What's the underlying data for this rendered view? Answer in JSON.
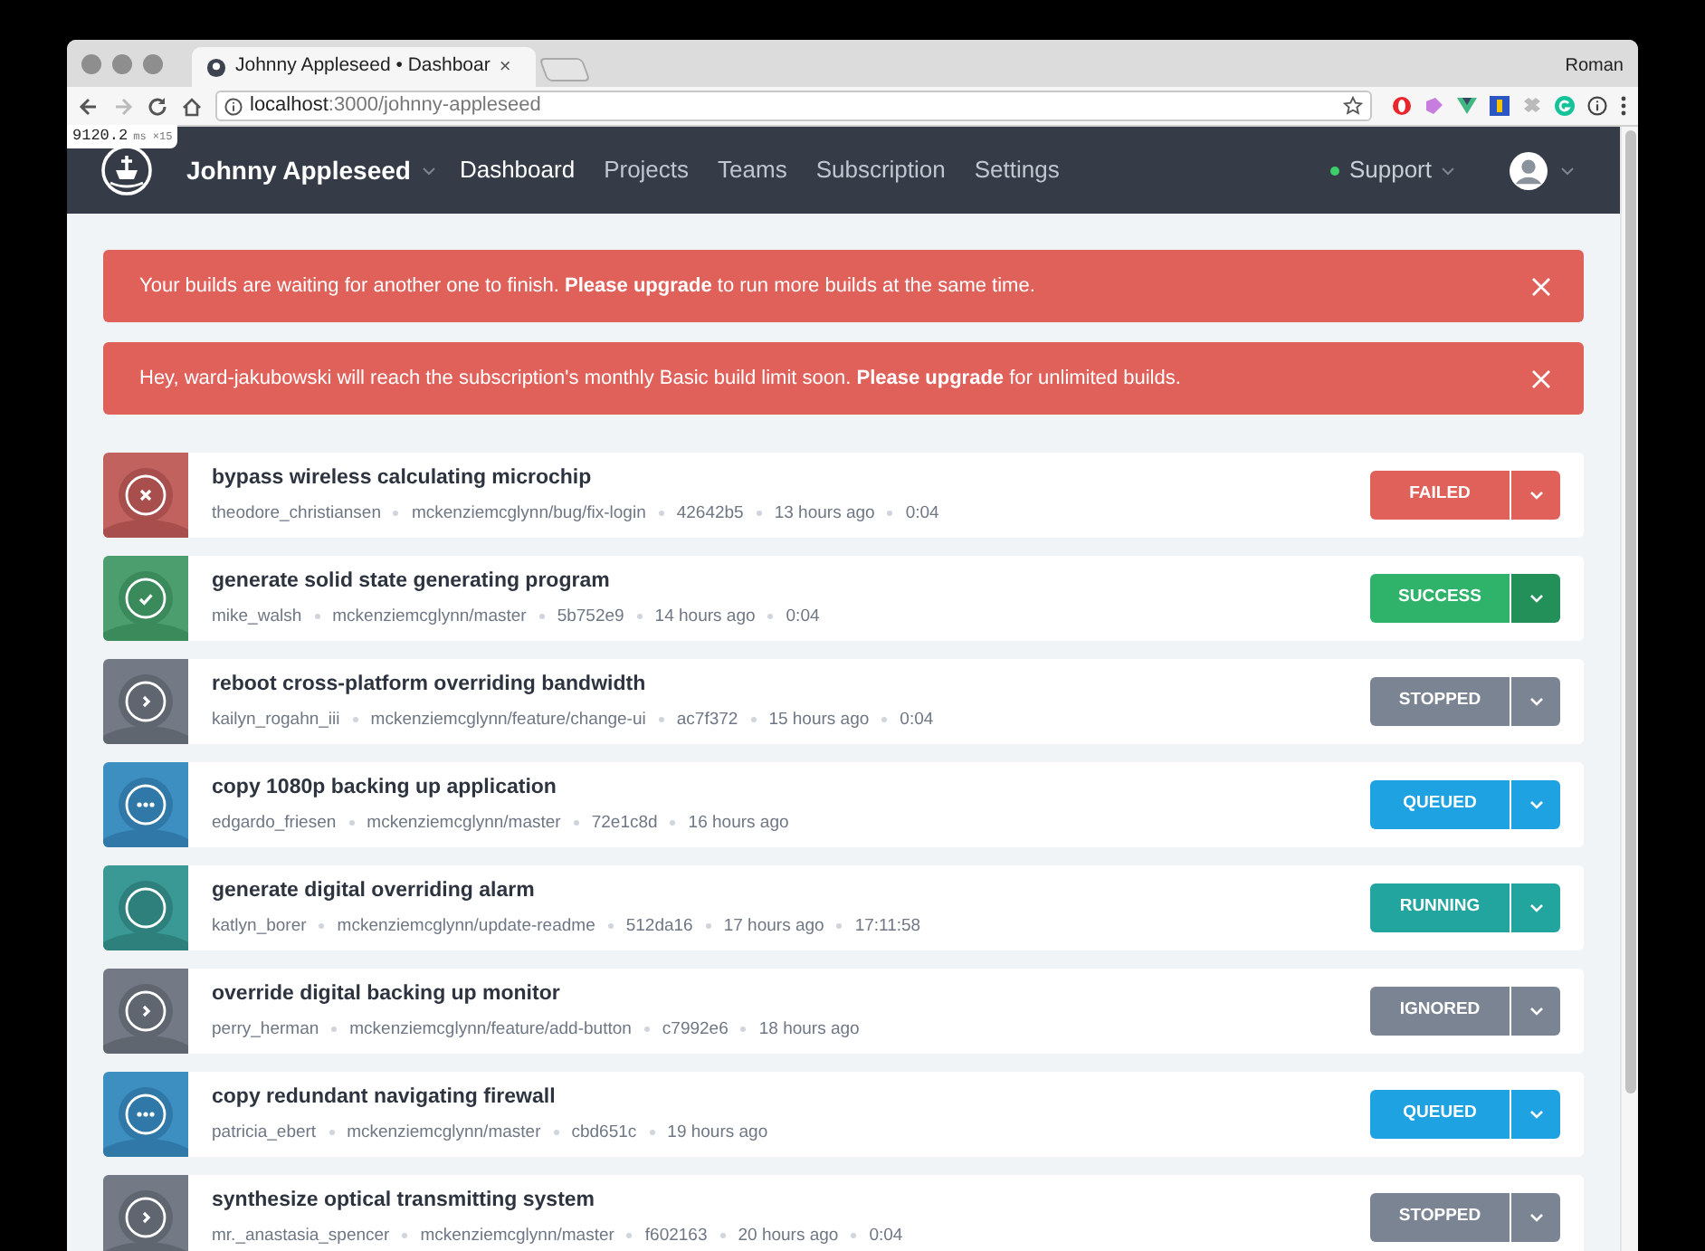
{
  "browser": {
    "tab": {
      "title": "Johnny Appleseed • Dashboar",
      "close": "×",
      "selected": true
    },
    "profile": "Roman",
    "url": {
      "host": "localhost",
      "path": ":3000/johnny-appleseed"
    },
    "perf": {
      "value": "9120.2",
      "unit": "ms ×15"
    }
  },
  "navbar": {
    "account": "Johnny Appleseed",
    "links": [
      {
        "label": "Dashboard",
        "selected": true
      },
      {
        "label": "Projects",
        "selected": false
      },
      {
        "label": "Teams",
        "selected": false
      },
      {
        "label": "Subscription",
        "selected": false
      },
      {
        "label": "Settings",
        "selected": false
      }
    ],
    "support": "Support"
  },
  "alerts": [
    {
      "text": "Your builds are waiting for another one to finish. **Please upgrade** to run more builds at the same time."
    },
    {
      "text": "Hey, ward-jakubowski will reach the subscription's monthly Basic build limit soon. **Please upgrade** for unlimited builds."
    }
  ],
  "builds": [
    {
      "title": "bypass wireless calculating microchip",
      "kind": "failed",
      "status": "FAILED",
      "meta": [
        "theodore_christiansen",
        "mckenziemcglynn/bug/fix-login",
        "42642b5",
        "13 hours ago",
        "0:04"
      ]
    },
    {
      "title": "generate solid state generating program",
      "kind": "success",
      "status": "SUCCESS",
      "meta": [
        "mike_walsh",
        "mckenziemcglynn/master",
        "5b752e9",
        "14 hours ago",
        "0:04"
      ]
    },
    {
      "title": "reboot cross-platform overriding bandwidth",
      "kind": "stopped",
      "status": "STOPPED",
      "meta": [
        "kailyn_rogahn_iii",
        "mckenziemcglynn/feature/change-ui",
        "ac7f372",
        "15 hours ago",
        "0:04"
      ]
    },
    {
      "title": "copy 1080p backing up application",
      "kind": "queued",
      "status": "QUEUED",
      "meta": [
        "edgardo_friesen",
        "mckenziemcglynn/master",
        "72e1c8d",
        "16 hours ago"
      ]
    },
    {
      "title": "generate digital overriding alarm",
      "kind": "running",
      "status": "RUNNING",
      "meta": [
        "katlyn_borer",
        "mckenziemcglynn/update-readme",
        "512da16",
        "17 hours ago",
        "17:11:58"
      ]
    },
    {
      "title": "override digital backing up monitor",
      "kind": "ignored",
      "status": "IGNORED",
      "meta": [
        "perry_herman",
        "mckenziemcglynn/feature/add-button",
        "c7992e6",
        "18 hours ago"
      ]
    },
    {
      "title": "copy redundant navigating firewall",
      "kind": "queued",
      "status": "QUEUED",
      "meta": [
        "patricia_ebert",
        "mckenziemcglynn/master",
        "cbd651c",
        "19 hours ago"
      ]
    },
    {
      "title": "synthesize optical transmitting system",
      "kind": "stopped",
      "status": "STOPPED",
      "meta": [
        "mr._anastasia_spencer",
        "mckenziemcglynn/master",
        "f602163",
        "20 hours ago",
        "0:04"
      ]
    }
  ]
}
